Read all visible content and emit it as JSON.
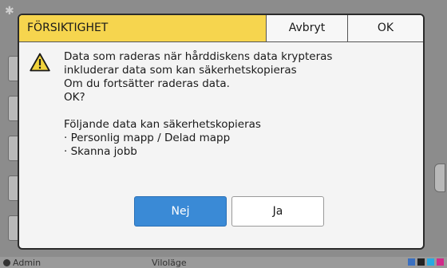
{
  "dialog": {
    "title": "FÖRSIKTIGHET",
    "cancel_label": "Avbryt",
    "ok_label": "OK",
    "message_lines": [
      "Data som raderas när hårddiskens data krypteras",
      "inkluderar data som kan säkerhetskopieras",
      "Om du fortsätter raderas data.",
      "OK?"
    ],
    "backup_lines": [
      "Följande data kan säkerhetskopieras",
      "· Personlig mapp / Delad mapp",
      "· Skanna jobb"
    ],
    "no_label": "Nej",
    "yes_label": "Ja",
    "icon": "warning-icon"
  },
  "status_bar": {
    "user": "Admin",
    "state": "Viloläge"
  },
  "colors": {
    "title_bg": "#f6d54e",
    "primary_button": "#3a8ad6",
    "warning_yellow": "#f1d33c"
  }
}
